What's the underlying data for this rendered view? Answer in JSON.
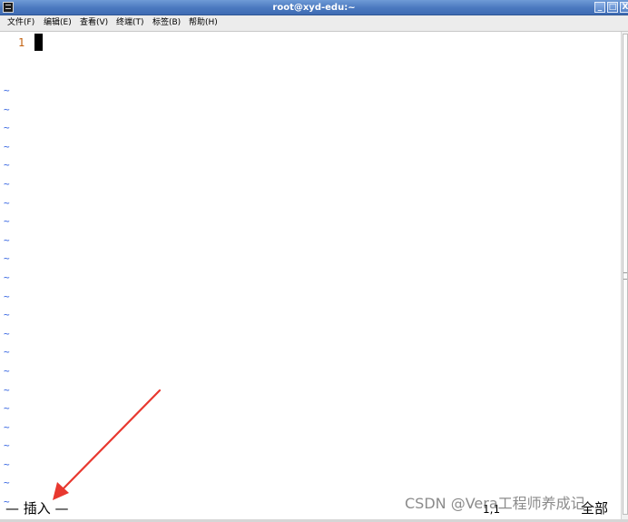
{
  "window": {
    "title": "root@xyd-edu:~",
    "controls": {
      "minimize": "_",
      "maximize": "□",
      "close": "X"
    }
  },
  "menu": [
    {
      "label": "文件(F)"
    },
    {
      "label": "编辑(E)"
    },
    {
      "label": "查看(V)"
    },
    {
      "label": "终端(T)"
    },
    {
      "label": "标签(B)"
    },
    {
      "label": "帮助(H)"
    }
  ],
  "editor": {
    "line_number": "1",
    "empty_line_marker": "~",
    "empty_line_count": 24
  },
  "status": {
    "mode": "— 插入 —",
    "position": "1,1",
    "scroll": "全部"
  },
  "watermark": "CSDN @Vera工程师养成记",
  "colors": {
    "line_number": "#c2600e",
    "tilde": "#2f60e0",
    "annotation_arrow": "#e8382f",
    "titlebar": "#4a78bf"
  }
}
